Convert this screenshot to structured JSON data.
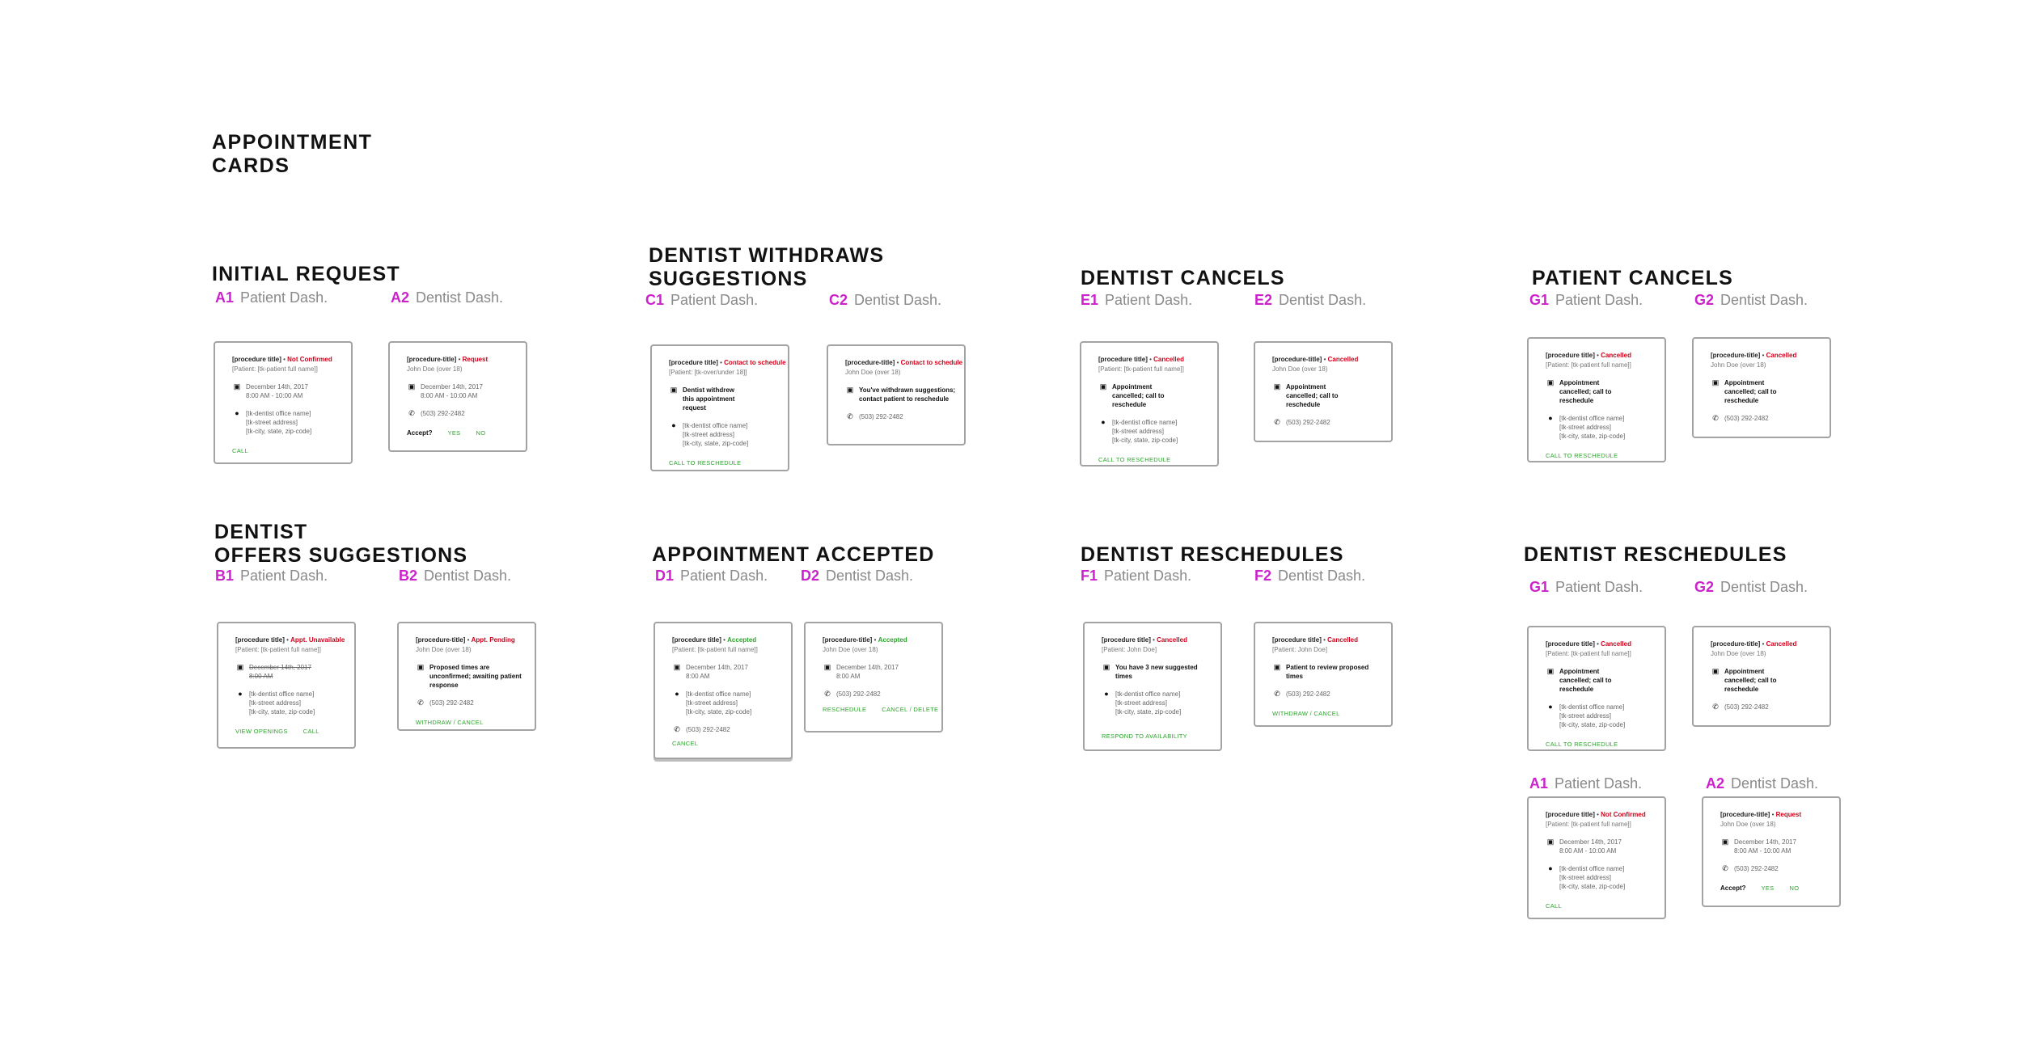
{
  "page": {
    "title_line1": "APPOINTMENT",
    "title_line2": "CARDS"
  },
  "common": {
    "proc": "[procedure title]",
    "proc_dash": "[procedure-title]",
    "dot": " • ",
    "patient": "[Patient: [tk-patient full name]]",
    "patient_under": "[Patient: [tk-over/under 18]]",
    "patient_john": "[Patient: John Doe]",
    "john": "John Doe (over 18)",
    "date": "December 14th, 2017",
    "time": "8:00 AM - 10:00 AM",
    "time_short": "8:00 AM",
    "office": "[tk-dentist office name]",
    "street": "[tk-street address]",
    "city": "[tk-city, state, zip-code]",
    "phone": "(503) 292-2482"
  },
  "status": {
    "not_confirmed": "Not Confirmed",
    "request": "Request",
    "contact": "Contact to schedule",
    "cancelled": "Cancelled",
    "unavailable": "Appt. Unavailable",
    "pending": "Appt. Pending",
    "accepted": "Accepted"
  },
  "messages": {
    "withdraw": "Dentist withdrew this appointment request",
    "withdrawn": "You've withdrawn suggestions; contact patient to reschedule",
    "cancelled": "Appointment cancelled; call to reschedule",
    "proposed": "Proposed times are unconfirmed; awaiting patient response",
    "three_new": "You have 3 new suggested times",
    "review": "Patient to review proposed times"
  },
  "actions": {
    "call": "CALL",
    "yes": "YES",
    "no": "NO",
    "accept_q": "Accept?",
    "call_reschedule": "CALL TO RESCHEDULE",
    "view_openings": "VIEW OPENINGS",
    "withdraw_cancel": "WITHDRAW / CANCEL",
    "cancel": "CANCEL",
    "reschedule": "RESCHEDULE",
    "cancel_delete": "CANCEL / DELETE",
    "respond": "RESPOND TO AVAILABILITY"
  },
  "labels": {
    "patient_dash": "Patient Dash.",
    "dentist_dash": "Dentist Dash."
  },
  "sections": {
    "initial": {
      "title1": "INITIAL REQUEST",
      "code_a": "A1",
      "code_b": "A2"
    },
    "withdraws": {
      "title1": "DENTIST WITHDRAWS",
      "title2": "SUGGESTIONS",
      "code_a": "C1",
      "code_b": "C2"
    },
    "dcancels": {
      "title1": "DENTIST CANCELS",
      "code_a": "E1",
      "code_b": "E2"
    },
    "pcancels": {
      "title1": "PATIENT CANCELS",
      "code_a": "G1",
      "code_b": "G2"
    },
    "offers": {
      "title1": "DENTIST",
      "title2": "OFFERS SUGGESTIONS",
      "code_a": "B1",
      "code_b": "B2"
    },
    "accepted": {
      "title1": "APPOINTMENT ACCEPTED",
      "code_a": "D1",
      "code_b": "D2"
    },
    "resched1": {
      "title1": "DENTIST RESCHEDULES",
      "code_a": "F1",
      "code_b": "F2"
    },
    "resched2": {
      "title1": "DENTIST RESCHEDULES",
      "code_a": "G1",
      "code_b": "G2"
    },
    "extra": {
      "code_a": "A1",
      "code_b": "A2"
    }
  },
  "colors": {
    "accent_code": "#cc22cc",
    "status_red": "#d0021b",
    "action_green": "#2aa62a",
    "card_border": "#a3a3a3"
  },
  "icons": [
    "calendar-icon",
    "location-pin-icon",
    "phone-icon"
  ]
}
